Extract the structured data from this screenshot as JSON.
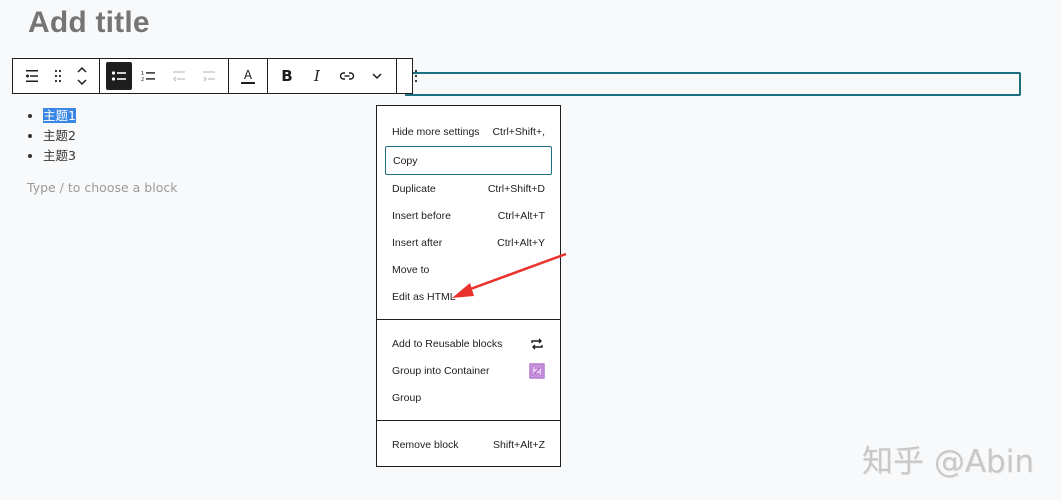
{
  "editor": {
    "title_placeholder": "Add title",
    "list_items": [
      "主题1",
      "主题2",
      "主题3"
    ],
    "selected_item_index": 0,
    "block_placeholder": "Type / to choose a block"
  },
  "toolbar": {
    "groups": [
      [
        {
          "icon": "list-block-icon",
          "label": "List"
        },
        {
          "icon": "drag-handle-icon",
          "label": "Drag"
        },
        {
          "icon": "move-up-down-icon",
          "label": "Move"
        }
      ],
      [
        {
          "icon": "unordered-list-icon",
          "label": "Unordered list",
          "active": true
        },
        {
          "icon": "ordered-list-icon",
          "label": "Ordered list"
        },
        {
          "icon": "outdent-icon",
          "label": "Outdent",
          "disabled": true
        },
        {
          "icon": "indent-icon",
          "label": "Indent",
          "disabled": true
        }
      ],
      [
        {
          "icon": "text-color-icon",
          "label": "A"
        }
      ],
      [
        {
          "icon": "bold-icon",
          "label": "B"
        },
        {
          "icon": "italic-icon",
          "label": "I"
        },
        {
          "icon": "link-icon",
          "label": "Link"
        },
        {
          "icon": "chevron-down-icon",
          "label": "More"
        }
      ],
      [
        {
          "icon": "more-vertical-icon",
          "label": "Options"
        }
      ]
    ],
    "text_color_label": "A",
    "bold_label": "B",
    "italic_label": "I"
  },
  "menu": {
    "sections": [
      {
        "items": [
          {
            "label": "Hide more settings",
            "shortcut": "Ctrl+Shift+,"
          },
          {
            "label": "Copy",
            "shortcut": "",
            "focused": true
          },
          {
            "label": "Duplicate",
            "shortcut": "Ctrl+Shift+D"
          },
          {
            "label": "Insert before",
            "shortcut": "Ctrl+Alt+T"
          },
          {
            "label": "Insert after",
            "shortcut": "Ctrl+Alt+Y"
          },
          {
            "label": "Move to",
            "shortcut": ""
          },
          {
            "label": "Edit as HTML",
            "shortcut": ""
          }
        ]
      },
      {
        "items": [
          {
            "label": "Add to Reusable blocks",
            "icon": "reusable-icon"
          },
          {
            "label": "Group into Container",
            "icon": "container-icon"
          },
          {
            "label": "Group"
          }
        ]
      },
      {
        "items": [
          {
            "label": "Remove block",
            "shortcut": "Shift+Alt+Z"
          }
        ]
      }
    ]
  },
  "annotation": {
    "color": "#e8322b"
  },
  "watermark": "知乎 @Abin"
}
